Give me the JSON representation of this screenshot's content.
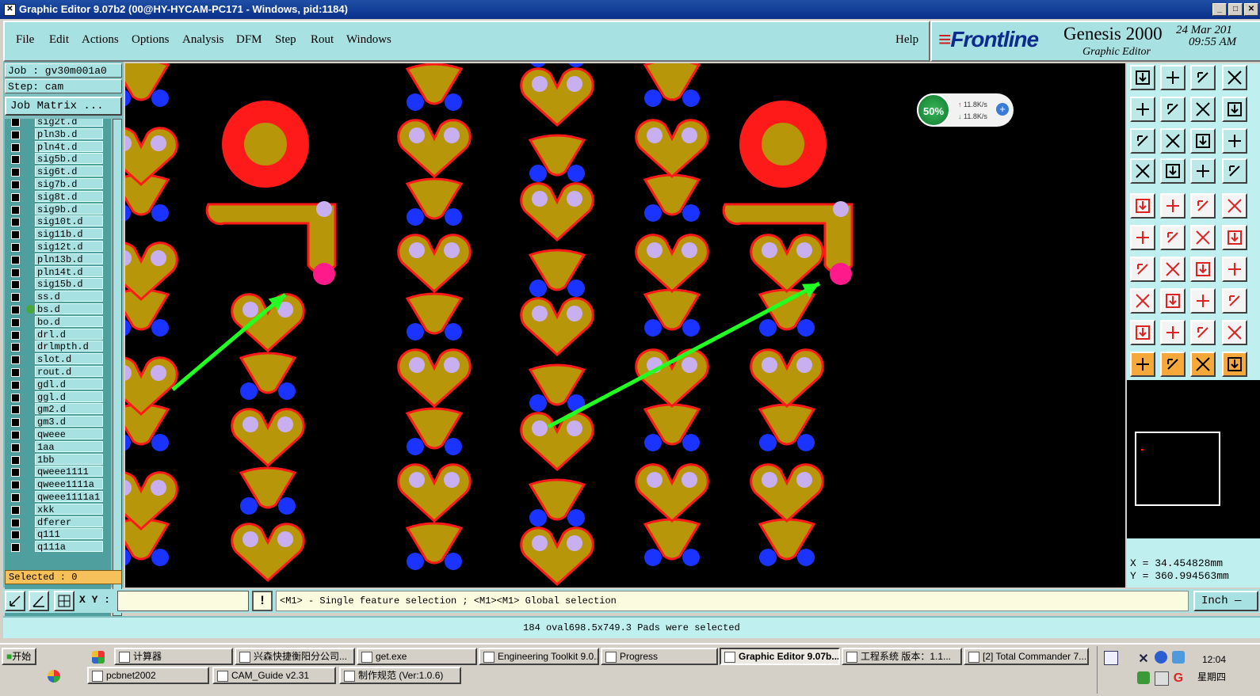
{
  "window": {
    "title": "Graphic Editor 9.07b2 (00@HY-HYCAM-PC171 - Windows, pid:1184)"
  },
  "menu": {
    "items": [
      "File",
      "Edit",
      "Actions",
      "Options",
      "Analysis",
      "DFM",
      "Step",
      "Rout",
      "Windows"
    ],
    "help": "Help"
  },
  "brand": {
    "logo": "Frontline",
    "product": "Genesis 2000",
    "subtitle": "Graphic Editor",
    "date": "24 Mar 201",
    "time": "09:55 AM"
  },
  "job": {
    "job_line": "Job : gv30m001a0",
    "step_line": "Step: cam",
    "matrix_button": "Job Matrix ..."
  },
  "layers": [
    {
      "name": "sig2t.d",
      "active": false,
      "affected": false
    },
    {
      "name": "pln3b.d",
      "active": false,
      "affected": false
    },
    {
      "name": "pln4t.d",
      "active": false,
      "affected": false
    },
    {
      "name": "sig5b.d",
      "active": false,
      "affected": false
    },
    {
      "name": "sig6t.d",
      "active": false,
      "affected": false
    },
    {
      "name": "sig7b.d",
      "active": false,
      "affected": false
    },
    {
      "name": "sig8t.d",
      "active": false,
      "affected": false
    },
    {
      "name": "sig9b.d",
      "active": false,
      "affected": false
    },
    {
      "name": "sig10t.d",
      "active": false,
      "affected": false
    },
    {
      "name": "sig11b.d",
      "active": false,
      "affected": false
    },
    {
      "name": "sig12t.d",
      "active": false,
      "affected": false
    },
    {
      "name": "pln13b.d",
      "active": false,
      "affected": false
    },
    {
      "name": "pln14t.d",
      "active": false,
      "affected": false
    },
    {
      "name": "sig15b.d",
      "active": false,
      "affected": false
    },
    {
      "name": "ss.d",
      "active": false,
      "affected": true
    },
    {
      "name": "bs.d",
      "active": true,
      "affected": true
    },
    {
      "name": "bo.d",
      "active": false,
      "affected": true
    },
    {
      "name": "drl.d",
      "active": false,
      "affected": false
    },
    {
      "name": "drlmpth.d",
      "active": false,
      "affected": false
    },
    {
      "name": "slot.d",
      "active": false,
      "affected": false
    },
    {
      "name": "rout.d",
      "active": false,
      "affected": false
    },
    {
      "name": "gdl.d",
      "active": false,
      "affected": true
    },
    {
      "name": "ggl.d",
      "active": false,
      "affected": false
    },
    {
      "name": "gm2.d",
      "active": false,
      "affected": false
    },
    {
      "name": "gm3.d",
      "active": false,
      "affected": false
    },
    {
      "name": "qweee",
      "active": false,
      "affected": false
    },
    {
      "name": "1aa",
      "active": false,
      "affected": false
    },
    {
      "name": "1bb",
      "active": false,
      "affected": false
    },
    {
      "name": "qweee1111",
      "active": false,
      "affected": false
    },
    {
      "name": "qweee1111a",
      "active": false,
      "affected": false
    },
    {
      "name": "qweee1111a1",
      "active": false,
      "affected": false
    },
    {
      "name": "xkk",
      "active": false,
      "affected": false
    },
    {
      "name": "dferer",
      "active": false,
      "affected": false
    },
    {
      "name": "q111",
      "active": false,
      "affected": false
    },
    {
      "name": "q111a",
      "active": false,
      "affected": false
    }
  ],
  "selected_label": "Selected : 0",
  "net_widget": {
    "percent": "50%",
    "up": "11.8K/s",
    "down": "11.8K/s"
  },
  "coords": {
    "x": "X = 34.454828mm",
    "y": "Y = 360.994563mm"
  },
  "command": {
    "xy_label": "X Y :",
    "xy_value": "",
    "excl": "!",
    "prompt": "<M1> - Single feature selection ; <M1><M1> Global selection",
    "unit": "Inch"
  },
  "status": "184 oval698.5x749.3 Pads were selected",
  "taskbar": {
    "start": "开始",
    "row1": [
      {
        "label": "计算器",
        "active": false
      },
      {
        "label": "兴森快捷衡阳分公司...",
        "active": false
      },
      {
        "label": "get.exe",
        "active": false
      },
      {
        "label": "Engineering Toolkit 9.0...",
        "active": false
      },
      {
        "label": "Progress",
        "active": false
      },
      {
        "label": "Graphic Editor 9.07b...",
        "active": true
      },
      {
        "label": "工程系统  版本：1.1...",
        "active": false
      },
      {
        "label": "[2] Total Commander 7....",
        "active": false
      }
    ],
    "row2": [
      {
        "label": "pcbnet2002",
        "active": false
      },
      {
        "label": "CAM_Guide v2.31",
        "active": false
      },
      {
        "label": "制作规范 (Ver:1.0.6)",
        "active": false
      }
    ],
    "clock": "12:04",
    "weekday": "星期四"
  },
  "colors": {
    "pad_fill": "#b8960a",
    "pad_outline": "#ff1a1a",
    "blue_pad": "#1a33ff",
    "highlight": "#c8b0f0",
    "arrow": "#22ff22",
    "panel": "#a7e1e1"
  }
}
